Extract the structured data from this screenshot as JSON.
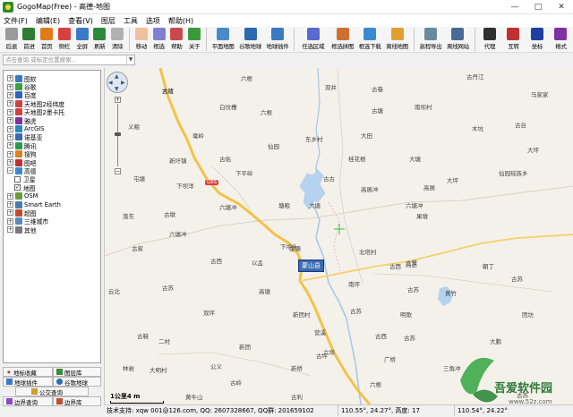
{
  "app": {
    "title": "GogoMap(Free) - 高德-地图"
  },
  "window_controls": {
    "min": "—",
    "max": "□",
    "close": "✕"
  },
  "menu": [
    "文件(F)",
    "编辑(E)",
    "查看(V)",
    "图层",
    "工具",
    "选项",
    "帮助(H)"
  ],
  "toolbar": [
    {
      "label": "后退",
      "icon": "back-icon",
      "color": "#9a9a9a"
    },
    {
      "label": "前进",
      "icon": "forward-icon",
      "color": "#2e7d32"
    },
    {
      "label": "首页",
      "icon": "home-icon",
      "color": "#e07b1a"
    },
    {
      "label": "侧栏",
      "icon": "sidebar-icon",
      "color": "#d84040"
    },
    {
      "label": "全屏",
      "icon": "fullscreen-icon",
      "color": "#3c78c8"
    },
    {
      "label": "刷新",
      "icon": "refresh-icon",
      "color": "#2a8a3a"
    },
    {
      "label": "清除",
      "icon": "clear-icon",
      "color": "#b0b0b0"
    },
    {
      "label": "移动",
      "icon": "hand-icon",
      "color": "#f0c09a"
    },
    {
      "label": "框选",
      "icon": "select-icon",
      "color": "#8080d0"
    },
    {
      "label": "帮助",
      "icon": "help-icon",
      "color": "#c84a4a"
    },
    {
      "label": "关于",
      "icon": "about-icon",
      "color": "#3a9a3a"
    },
    {
      "label": "平面地图",
      "icon": "flat-map-icon",
      "color": "#4a8ac8"
    },
    {
      "label": "谷歌地球",
      "icon": "google-earth-icon",
      "color": "#2a6ab0"
    },
    {
      "label": "地球插件",
      "icon": "earth-plugin-icon",
      "color": "#3a7ac0"
    },
    {
      "label": "任选区域",
      "icon": "region-icon",
      "color": "#5a6ad0"
    },
    {
      "label": "框选拼图",
      "icon": "mosaic-icon",
      "color": "#d07030"
    },
    {
      "label": "框选下载",
      "icon": "download-icon",
      "color": "#3a8ad0"
    },
    {
      "label": "离线地图",
      "icon": "offline-map-icon",
      "color": "#e0a030"
    },
    {
      "label": "高程导出",
      "icon": "elevation-icon",
      "color": "#6a8aa0"
    },
    {
      "label": "离线网站",
      "icon": "offline-site-icon",
      "color": "#4a6a9a"
    },
    {
      "label": "代理",
      "icon": "proxy-icon",
      "color": "#303030"
    },
    {
      "label": "互转",
      "icon": "convert-icon",
      "color": "#c03030"
    },
    {
      "label": "坐标",
      "icon": "coord-icon",
      "color": "#2040a0"
    },
    {
      "label": "格式",
      "icon": "format-icon",
      "color": "#8030a0"
    }
  ],
  "search": {
    "placeholder": "点击查询,或标定位置搜索..."
  },
  "tree": [
    {
      "label": "图软",
      "color": "#3a7ac0",
      "child": false
    },
    {
      "label": "谷歌",
      "color": "#3aa040",
      "child": false
    },
    {
      "label": "百度",
      "color": "#3060c0",
      "child": false
    },
    {
      "label": "天地图2经纬度",
      "color": "#d04040",
      "child": false
    },
    {
      "label": "天地图2墨卡托",
      "color": "#d04040",
      "child": false
    },
    {
      "label": "雅虎",
      "color": "#8030a0",
      "child": false
    },
    {
      "label": "ArcGIS",
      "color": "#2a8ac0",
      "child": false
    },
    {
      "label": "诺基亚",
      "color": "#3a6ab0",
      "child": false
    },
    {
      "label": "腾讯",
      "color": "#2a9a4a",
      "child": false
    },
    {
      "label": "搜狗",
      "color": "#e08020",
      "child": false
    },
    {
      "label": "图吧",
      "color": "#c03030",
      "child": false
    },
    {
      "label": "高德",
      "color": "#3a8ad0",
      "child": false,
      "expanded": true
    },
    {
      "label": "卫星",
      "child": true,
      "checked": false
    },
    {
      "label": "地图",
      "child": true,
      "checked": true
    },
    {
      "label": "OSM",
      "color": "#6a9a3a",
      "child": false
    },
    {
      "label": "Smart Earth",
      "color": "#4a7ab0",
      "child": false
    },
    {
      "label": "超图",
      "color": "#c04a2a",
      "child": false
    },
    {
      "label": "三维城市",
      "color": "#5a8ac0",
      "child": false
    },
    {
      "label": "其他",
      "color": "#7a7a7a",
      "child": false
    }
  ],
  "left_tabs": [
    "地标收藏",
    "图层库",
    "地球插件",
    "谷歌地球",
    "公交查询",
    "边界查询",
    "边界库"
  ],
  "map": {
    "places": [
      "大清",
      "六根",
      "双井",
      "古巷",
      "古丹江",
      "白坟槽",
      "六根",
      "古塘",
      "南坝村",
      "马家家",
      "义粮",
      "毫岭",
      "东乡村",
      "大田",
      "古台",
      "木坑",
      "新圩镇",
      "古佑",
      "仙园",
      "大坪",
      "下平岭",
      "桂花根",
      "古古",
      "大塘",
      "大坪",
      "仙园瑶族乡",
      "屯塘",
      "塘粮",
      "大塘",
      "高展",
      "下坝洋",
      "高展冲",
      "六塘冲",
      "落东",
      "古墩",
      "果墩",
      "六塘冲",
      "六塘冲",
      "下坝头",
      "北塔村",
      "古家",
      "六莫",
      "古西",
      "以孟",
      "金塘",
      "高芝",
      "朝丁",
      "古西",
      "古苏",
      "云北",
      "古苏",
      "高塘",
      "南坪",
      "古苏",
      "黄竹",
      "双坪",
      "新团村",
      "古苏",
      "团坊",
      "古鞋",
      "二村",
      "营溪",
      "古西",
      "六坝",
      "古苏",
      "林岩",
      "公义",
      "新桥",
      "广桥",
      "古岭",
      "六根",
      "大鹏",
      "古利",
      "大明村",
      "三角冲",
      "黄牛山",
      "古坪",
      "新团",
      "明歌",
      "古苏",
      "古红"
    ],
    "county_label": "蒙山县",
    "road_badge": "G65",
    "scale_text": "1公里4 m"
  },
  "status": {
    "support": "技术支持: xqw 001@126.com, QQ: 2607328667, QQ群: 201659102",
    "coord1": "110.55°, 24.27°, 高度: 17",
    "coord2": "110.54°, 24.22°"
  },
  "watermark": {
    "text": "吾爱软件园",
    "url": "www.52z.com"
  },
  "colors": {
    "accent": "#3a7ac0",
    "road_main": "#f4c247",
    "river": "#a8c8e8",
    "water": "#b5d3ee",
    "map_bg": "#f4f1ea"
  }
}
